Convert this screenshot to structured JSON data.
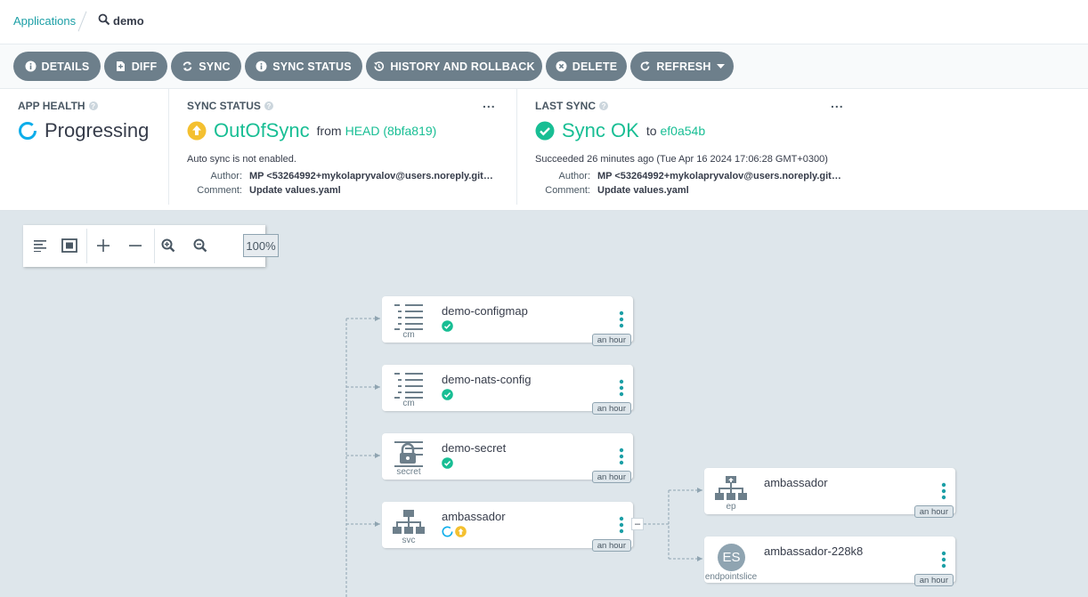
{
  "breadcrumb": {
    "parent": "Applications",
    "current": "demo"
  },
  "toolbar": {
    "details": "DETAILS",
    "diff": "DIFF",
    "sync": "SYNC",
    "sync_status": "SYNC STATUS",
    "history": "HISTORY AND ROLLBACK",
    "delete": "DELETE",
    "refresh": "REFRESH"
  },
  "app_health": {
    "title": "APP HEALTH",
    "value": "Progressing"
  },
  "sync_status": {
    "title": "SYNC STATUS",
    "value": "OutOfSync",
    "from_label": "from",
    "revision": "HEAD (8bfa819)",
    "auto_sync": "Auto sync is not enabled.",
    "author_label": "Author:",
    "author": "MP <53264992+mykolapryvalov@users.noreply.githu...",
    "comment_label": "Comment:",
    "comment": "Update values.yaml",
    "menu": "..."
  },
  "last_sync": {
    "title": "LAST SYNC",
    "value": "Sync OK",
    "to_label": "to",
    "revision": "ef0a54b",
    "succeeded": "Succeeded 26 minutes ago (Tue Apr 16 2024 17:06:28 GMT+0300)",
    "author_label": "Author:",
    "author": "MP <53264992+mykolapryvalov@users.noreply.githu...",
    "comment_label": "Comment:",
    "comment": "Update values.yaml",
    "menu": "..."
  },
  "graph_controls": {
    "zoom": "100%"
  },
  "nodes": [
    {
      "name": "demo-configmap",
      "kind": "cm",
      "age": "an hour"
    },
    {
      "name": "demo-nats-config",
      "kind": "cm",
      "age": "an hour"
    },
    {
      "name": "demo-secret",
      "kind": "secret",
      "age": "an hour"
    },
    {
      "name": "ambassador",
      "kind": "svc",
      "age": "an hour"
    },
    {
      "name": "ambassador",
      "kind": "ep",
      "age": "an hour"
    },
    {
      "name": "ambassador-228k8",
      "kind": "endpointslice",
      "age": "an hour",
      "badge": "ES"
    }
  ],
  "collapse_symbol": "–",
  "colors": {
    "teal": "#18be94",
    "link": "#1c9fa6",
    "warning": "#f4c030",
    "button": "#6d7f8b",
    "progress": "#0dadea"
  }
}
